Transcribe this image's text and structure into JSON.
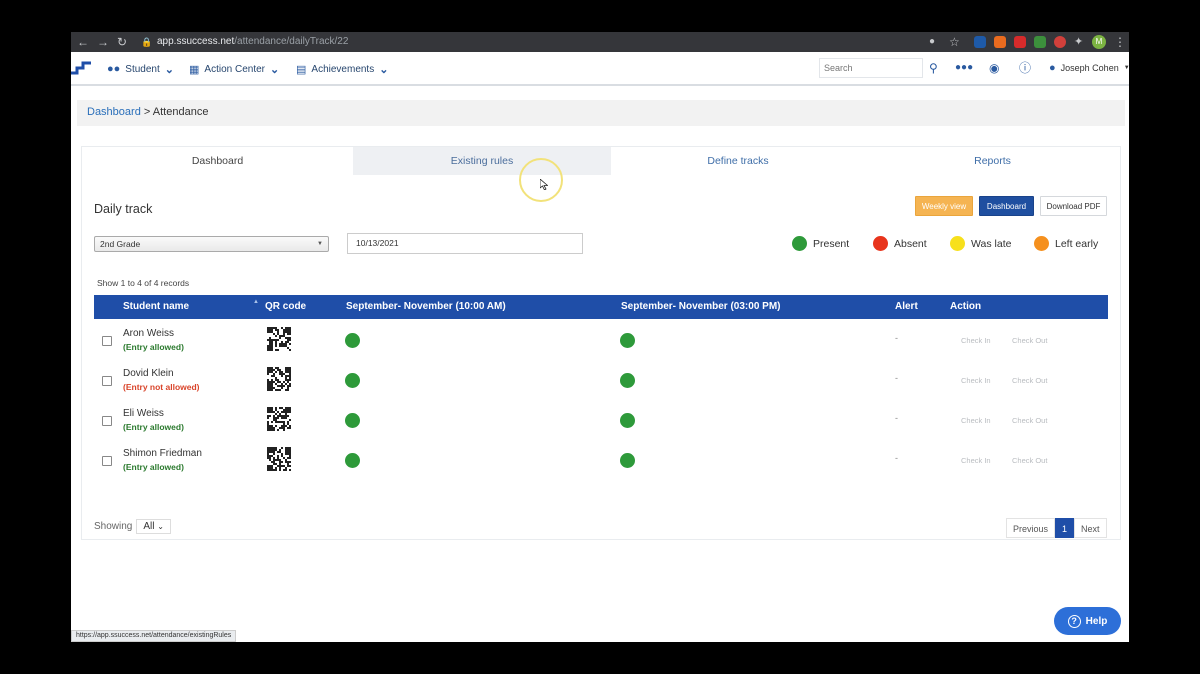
{
  "browser": {
    "url_host": "app.ssuccess.net",
    "url_path": "/attendance/dailyTrack/22",
    "status_url": "https://app.ssuccess.net/attendance/existingRules",
    "profile_initial": "M"
  },
  "nav": {
    "items": [
      {
        "label": "Student",
        "icon": "users-icon"
      },
      {
        "label": "Action Center",
        "icon": "calendar-icon"
      },
      {
        "label": "Achievements",
        "icon": "list-icon"
      }
    ],
    "search_placeholder": "Search",
    "user_name": "Joseph Cohen"
  },
  "breadcrumb": {
    "link": "Dashboard",
    "separator": ">",
    "current": "Attendance"
  },
  "tabs": [
    {
      "label": "Dashboard"
    },
    {
      "label": "Existing rules"
    },
    {
      "label": "Define tracks"
    },
    {
      "label": "Reports"
    }
  ],
  "daily": {
    "title": "Daily track",
    "weekly_view": "Weekly view",
    "dashboard_btn": "Dashboard",
    "download_pdf": "Download PDF",
    "grade": "2nd Grade",
    "date": "10/13/2021"
  },
  "legend": [
    {
      "label": "Present",
      "color": "#2e9a3a"
    },
    {
      "label": "Absent",
      "color": "#e8341c"
    },
    {
      "label": "Was late",
      "color": "#f7e01c"
    },
    {
      "label": "Left early",
      "color": "#f5901e"
    }
  ],
  "table": {
    "records_text": "Show 1 to 4 of 4 records",
    "headers": {
      "student_name": "Student name",
      "qr_code": "QR code",
      "period1": "September- November (10:00 AM)",
      "period2": "September- November (03:00 PM)",
      "alert": "Alert",
      "action": "Action"
    },
    "rows": [
      {
        "name": "Aron Weiss",
        "entry": "(Entry allowed)",
        "entry_color": "#2b7a2e",
        "alert": "-",
        "check_in": "Check In",
        "check_out": "Check Out"
      },
      {
        "name": "Dovid Klein",
        "entry": "(Entry not allowed)",
        "entry_color": "#d9442a",
        "alert": "-",
        "check_in": "Check In",
        "check_out": "Check Out"
      },
      {
        "name": "Eli Weiss",
        "entry": "(Entry allowed)",
        "entry_color": "#2b7a2e",
        "alert": "-",
        "check_in": "Check In",
        "check_out": "Check Out"
      },
      {
        "name": "Shimon Friedman",
        "entry": "(Entry allowed)",
        "entry_color": "#2b7a2e",
        "alert": "-",
        "check_in": "Check In",
        "check_out": "Check Out"
      }
    ],
    "showing_label": "Showing",
    "showing_value": "All"
  },
  "pager": {
    "previous": "Previous",
    "current": "1",
    "next": "Next"
  },
  "help_label": "Help"
}
